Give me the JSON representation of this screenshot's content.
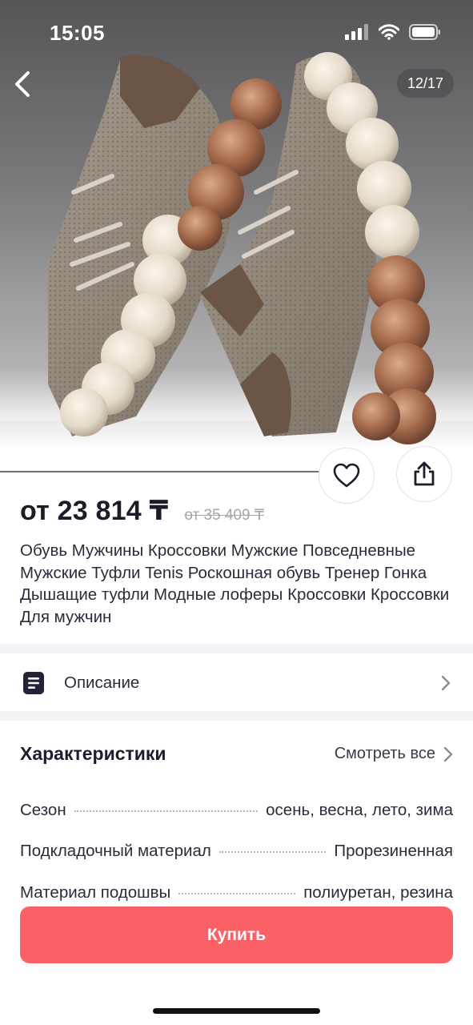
{
  "status_bar": {
    "time": "15:05"
  },
  "gallery": {
    "counter": "12/17"
  },
  "product": {
    "price": "от 23 814 ₸",
    "old_price": "от 35 409 ₸",
    "title": "Обувь Мужчины Кроссовки Мужские Повседневные Мужские Туфли Tenis Роскошная обувь Тренер Гонка Дышащие туфли Модные лоферы Кроссовки Кроссовки Для мужчин"
  },
  "description": {
    "label": "Описание"
  },
  "characteristics": {
    "title": "Характеристики",
    "see_all": "Смотреть все",
    "items": [
      {
        "name": "Сезон",
        "value": "осень, весна, лето, зима"
      },
      {
        "name": "Подкладочный материал",
        "value": "Прорезиненная"
      },
      {
        "name": "Материал подошвы",
        "value": "полиуретан, резина"
      }
    ]
  },
  "actions": {
    "buy": "Купить"
  },
  "icons": {
    "back": "chevron-left-icon",
    "favorite": "heart-icon",
    "share": "share-icon",
    "description": "document-icon",
    "chevron": "chevron-right-icon"
  },
  "colors": {
    "accent": "#f96167",
    "price": "#1b1b2a",
    "old_price": "#a5a5ad"
  }
}
